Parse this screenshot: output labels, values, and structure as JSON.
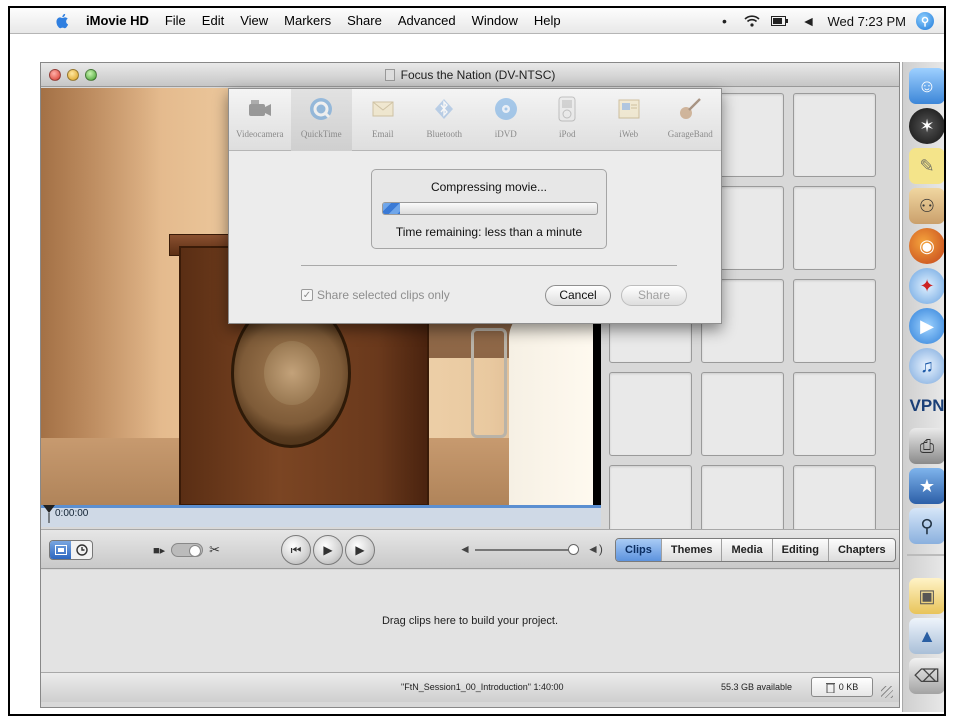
{
  "menubar": {
    "app_name": "iMovie HD",
    "menus": [
      "File",
      "Edit",
      "View",
      "Markers",
      "Share",
      "Advanced",
      "Window",
      "Help"
    ],
    "clock": "Wed 7:23 PM"
  },
  "window": {
    "title": "Focus the Nation (DV-NTSC)"
  },
  "monitor": {
    "timecode": "0:00:00"
  },
  "share_sheet": {
    "destinations": [
      "Videocamera",
      "QuickTime",
      "Email",
      "Bluetooth",
      "iDVD",
      "iPod",
      "iWeb",
      "GarageBand"
    ],
    "selected": "QuickTime",
    "progress_title": "Compressing movie...",
    "progress_fraction": 0.08,
    "time_remaining": "Time remaining: less than a minute",
    "share_selected_label": "Share selected clips only",
    "cancel_label": "Cancel",
    "share_label": "Share"
  },
  "pane_tabs": {
    "tabs": [
      "Clips",
      "Themes",
      "Media",
      "Editing",
      "Chapters"
    ],
    "active": "Clips"
  },
  "timeline": {
    "message": "Drag clips here to build your project."
  },
  "statusbar": {
    "project": "\"FtN_Session1_00_Introduction\"  1:40:00",
    "space": "55.3 GB available",
    "trash": "0 KB"
  },
  "dock": {
    "vpn_label": "VPN"
  },
  "colors": {
    "accent": "#5d93de",
    "progress": "#3a7ad6"
  }
}
